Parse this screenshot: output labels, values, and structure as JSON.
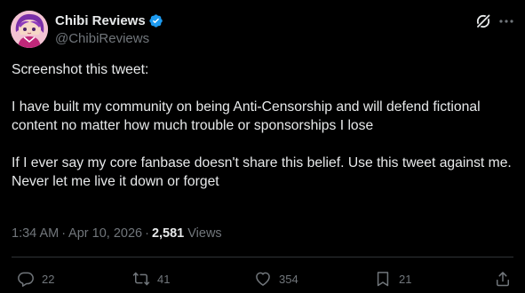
{
  "author": {
    "display_name": "Chibi Reviews",
    "handle": "@ChibiReviews",
    "verified": true
  },
  "tweet": {
    "paragraphs": [
      "Screenshot this tweet:",
      "I have built my community on being Anti-Censorship and will defend fictional content no matter how much trouble or sponsorships I lose",
      "If I ever say my core fanbase doesn't share this belief. Use this tweet against me. Never let me live it down or forget"
    ]
  },
  "meta": {
    "time": "1:34 AM",
    "separator": "·",
    "date": "Apr 10, 2026",
    "views_count": "2,581",
    "views_label": "Views"
  },
  "actions": {
    "replies": "22",
    "reposts": "41",
    "likes": "354",
    "bookmarks": "21"
  },
  "icons": {
    "verified": "verified-badge-icon",
    "grok": "grok-icon",
    "more": "more-dots-icon",
    "reply": "reply-bubble-icon",
    "repost": "repost-icon",
    "like": "heart-icon",
    "bookmark": "bookmark-icon",
    "share": "share-icon"
  },
  "colors": {
    "background": "#000000",
    "text": "#e7e9ea",
    "muted": "#71767b",
    "verified": "#1d9bf0",
    "divider": "#2f3336"
  }
}
